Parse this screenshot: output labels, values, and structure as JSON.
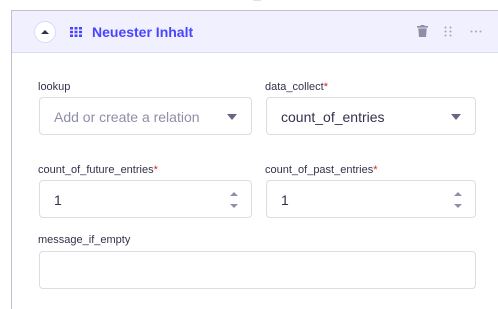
{
  "header": {
    "title": "Neuester Inhalt"
  },
  "fields": {
    "lookup": {
      "label": "lookup",
      "placeholder": "Add or create a relation"
    },
    "data_collect": {
      "label": "data_collect",
      "required_mark": "*",
      "value": "count_of_entries"
    },
    "count_of_future_entries": {
      "label": "count_of_future_entries",
      "required_mark": "*",
      "value": "1"
    },
    "count_of_past_entries": {
      "label": "count_of_past_entries",
      "required_mark": "*",
      "value": "1"
    },
    "message_if_empty": {
      "label": "message_if_empty",
      "value": ""
    }
  },
  "colors": {
    "accent": "#4945ff",
    "header_bg": "#f0f0ff",
    "required": "#d02b20",
    "border": "#dcdce4"
  },
  "icons": {
    "collapse": "chevron-up-icon",
    "component": "grid-icon",
    "delete": "trash-icon",
    "drag": "drag-handle-icon",
    "more": "more-icon"
  }
}
